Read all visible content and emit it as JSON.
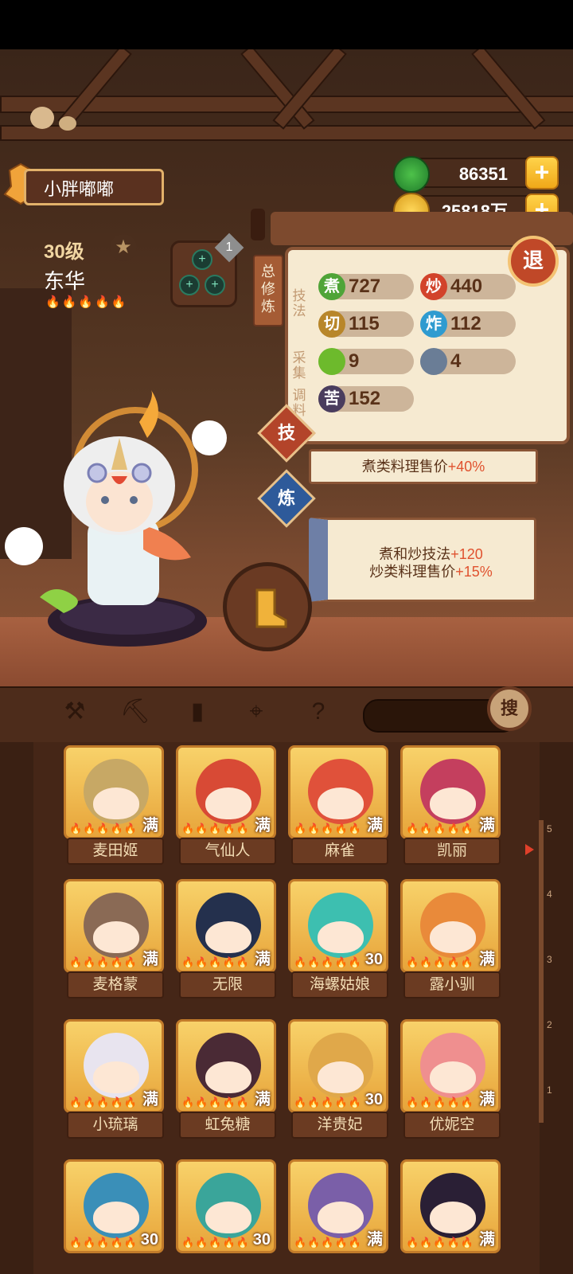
{
  "player": {
    "name": "小胖嘟嘟"
  },
  "currency": {
    "jade": "86351",
    "gold": "25818万",
    "plus": "+"
  },
  "chef": {
    "level": "30级",
    "name": "东华",
    "flames": "🔥🔥🔥🔥🔥"
  },
  "equipment": {
    "count": "1"
  },
  "panel": {
    "tab_label": "总修炼",
    "exit_label": "退",
    "sections": {
      "technique": "技法",
      "gather": "采集",
      "season": "调料"
    },
    "stats": [
      {
        "icon": "煮",
        "value": "727",
        "color": "#4fa438"
      },
      {
        "icon": "炒",
        "value": "440",
        "color": "#d2432b"
      },
      {
        "icon": "切",
        "value": "115",
        "color": "#b8862a"
      },
      {
        "icon": "炸",
        "value": "112",
        "color": "#2f9bd0"
      },
      {
        "icon": "",
        "value": "9",
        "color": "#6dba2c"
      },
      {
        "icon": "",
        "value": "4",
        "color": "#6a7d96"
      },
      {
        "icon": "苦",
        "value": "152",
        "color": "#4a3d5e"
      }
    ]
  },
  "skill": {
    "label": "技",
    "text": "煮类料理售价",
    "bonus": "+40%"
  },
  "refine": {
    "label": "炼",
    "line1": "煮和炒技法",
    "bonus1": "+120",
    "line2": "炒类料理售价",
    "bonus2": "+15%"
  },
  "toolbar": {
    "search_label": "搜"
  },
  "cards": [
    {
      "name": "麦田姬",
      "badge": "满",
      "hair": "#c7a865"
    },
    {
      "name": "气仙人",
      "badge": "满",
      "hair": "#d84a35"
    },
    {
      "name": "麻雀",
      "badge": "满",
      "hair": "#e0513a"
    },
    {
      "name": "凯丽",
      "badge": "满",
      "hair": "#c43f5e"
    },
    {
      "name": "麦格蒙",
      "badge": "满",
      "hair": "#8a6a55"
    },
    {
      "name": "无限",
      "badge": "满",
      "hair": "#24304d"
    },
    {
      "name": "海螺姑娘",
      "badge": "30",
      "hair": "#3dbfb0"
    },
    {
      "name": "露小驯",
      "badge": "满",
      "hair": "#e98a3a"
    },
    {
      "name": "小琉璃",
      "badge": "满",
      "hair": "#e8e4ef"
    },
    {
      "name": "虹兔糖",
      "badge": "满",
      "hair": "#4a2a35"
    },
    {
      "name": "洋贵妃",
      "badge": "30",
      "hair": "#e0a84a"
    },
    {
      "name": "优妮空",
      "badge": "满",
      "hair": "#ef8f8f"
    },
    {
      "name": "",
      "badge": "30",
      "hair": "#3a8fb8"
    },
    {
      "name": "",
      "badge": "30",
      "hair": "#3aa59a"
    },
    {
      "name": "",
      "badge": "满",
      "hair": "#7a5fa8"
    },
    {
      "name": "",
      "badge": "满",
      "hair": "#2a1f35"
    }
  ],
  "ruler": {
    "ticks": [
      "5",
      "4",
      "3",
      "2",
      "1"
    ]
  }
}
